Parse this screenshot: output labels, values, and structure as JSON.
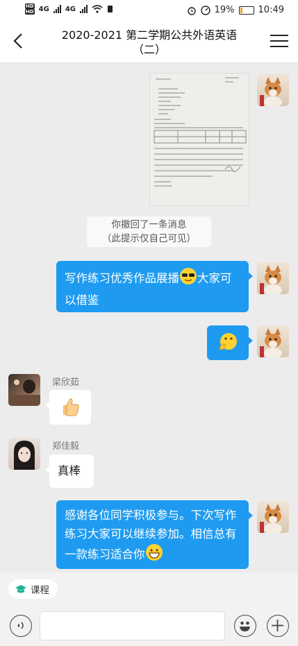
{
  "status_bar": {
    "network_left": "4G",
    "network_right": "4G",
    "hd": "HD",
    "battery": "19%",
    "time": "10:49",
    "battery_level": 0.19
  },
  "header": {
    "title": "2020-2021 第二学期公共外语英语（二）"
  },
  "messages": {
    "recall_line1": "你撤回了一条消息",
    "recall_line2": "（此提示仅自己可见）",
    "msg1": "写作练习优秀作品展播",
    "msg1_tail": "大家可以借鉴",
    "sender1": "梁欣茹",
    "sender2": "郑佳毅",
    "msg_reply2": "真棒",
    "msg_last": "感谢各位同学积极参与。下次写作练习大家可以继续参加。相信总有一款练习适合你"
  },
  "bottom": {
    "chip_label": "课程",
    "input_value": ""
  },
  "colors": {
    "bubble_blue": "#1e9bf0",
    "background": "#ececec"
  }
}
